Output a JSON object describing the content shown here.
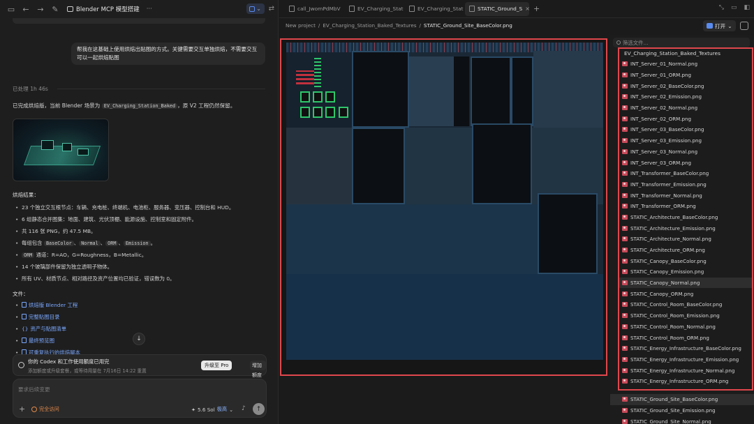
{
  "left": {
    "title": "Blender MCP 模型搭建",
    "user_message": "帮我在这基础上使用烘焙出贴图的方式。关键需要交互单独烘焙，不需要交互可以一起烘焙贴图",
    "processed": "已处理 1h 46s",
    "summary_pre": "已完成烘焙版，当前 Blender 场景为",
    "summary_code": "EV_Charging_Station_Baked",
    "summary_post": "，原 V2 工程仍然保留。",
    "results_heading": "烘焙结果：",
    "bullets": {
      "b1": "23 个独立交互根节点：车辆、充电桩、终端机、电池柜、服务器、变压器、控制台和 HUD。",
      "b2": "6 组静态合并图集：地面、建筑、光伏顶棚、能源设施、控制室和固定附件。",
      "b3": "共 116 张 PNG，约 47.5 MB。",
      "b4_pre": "每组包含",
      "b4_c1": "BaseColor",
      "b4_c2": "Normal",
      "b4_c3": "ORM",
      "b4_c4": "Emission",
      "b4_post": "。",
      "b5_code": "ORM",
      "b5_post": "通道：R=AO，G=Roughness，B=Metallic。",
      "b6": "14 个玻璃部件保留为独立透明子物体。",
      "b7": "所有 UV、材质节点、相对路径及资产位置均已验证，错误数为 0。"
    },
    "files_heading": "文件：",
    "files": [
      "烘焙版 Blender 工程",
      "完整贴图目录",
      "资产与贴图清单",
      "最终预览图",
      "可重复执行的烘焙脚本"
    ],
    "quota": {
      "title": "你的 Codex 和工作使用额度已用完",
      "subtitle": "添加额度或升级套餐，或等待用量在 7月16日 14:22 重置",
      "upgrade": "升级至 Pro",
      "add": "增加额度"
    },
    "composer": {
      "placeholder": "要求后续变更",
      "access": "完全访问",
      "model": "5.6 Sol",
      "effort": "极高"
    }
  },
  "right": {
    "tabs": [
      "call_JwomPdMbV",
      "EV_Charging_Stat",
      "EV_Charging_Stat",
      "STATIC_Ground_S"
    ],
    "crumbs": [
      "New project",
      "EV_Charging_Station_Baked_Textures",
      "STATIC_Ground_Site_BaseColor.png"
    ],
    "open_label": "打开",
    "search_placeholder": "筛选文件...",
    "folder_name": "EV_Charging_Station_Baked_Textures",
    "files": [
      "INT_Server_01_Normal.png",
      "INT_Server_01_ORM.png",
      "INT_Server_02_BaseColor.png",
      "INT_Server_02_Emission.png",
      "INT_Server_02_Normal.png",
      "INT_Server_02_ORM.png",
      "INT_Server_03_BaseColor.png",
      "INT_Server_03_Emission.png",
      "INT_Server_03_Normal.png",
      "INT_Server_03_ORM.png",
      "INT_Transformer_BaseColor.png",
      "INT_Transformer_Emission.png",
      "INT_Transformer_Normal.png",
      "INT_Transformer_ORM.png",
      "STATIC_Architecture_BaseColor.png",
      "STATIC_Architecture_Emission.png",
      "STATIC_Architecture_Normal.png",
      "STATIC_Architecture_ORM.png",
      "STATIC_Canopy_BaseColor.png",
      "STATIC_Canopy_Emission.png",
      "STATIC_Canopy_Normal.png",
      "STATIC_Canopy_ORM.png",
      "STATIC_Control_Room_BaseColor.png",
      "STATIC_Control_Room_Emission.png",
      "STATIC_Control_Room_Normal.png",
      "STATIC_Control_Room_ORM.png",
      "STATIC_Energy_Infrastructure_BaseColor.png",
      "STATIC_Energy_Infrastructure_Emission.png",
      "STATIC_Energy_Infrastructure_Normal.png",
      "STATIC_Energy_Infrastructure_ORM.png"
    ],
    "files_below": [
      "STATIC_Ground_Site_BaseColor.png",
      "STATIC_Ground_Site_Emission.png",
      "STATIC_Ground_Site_Normal.png"
    ]
  },
  "colors": {
    "highlight": "#e0474c",
    "link": "#7aa8ff",
    "access": "#e38a4a"
  }
}
